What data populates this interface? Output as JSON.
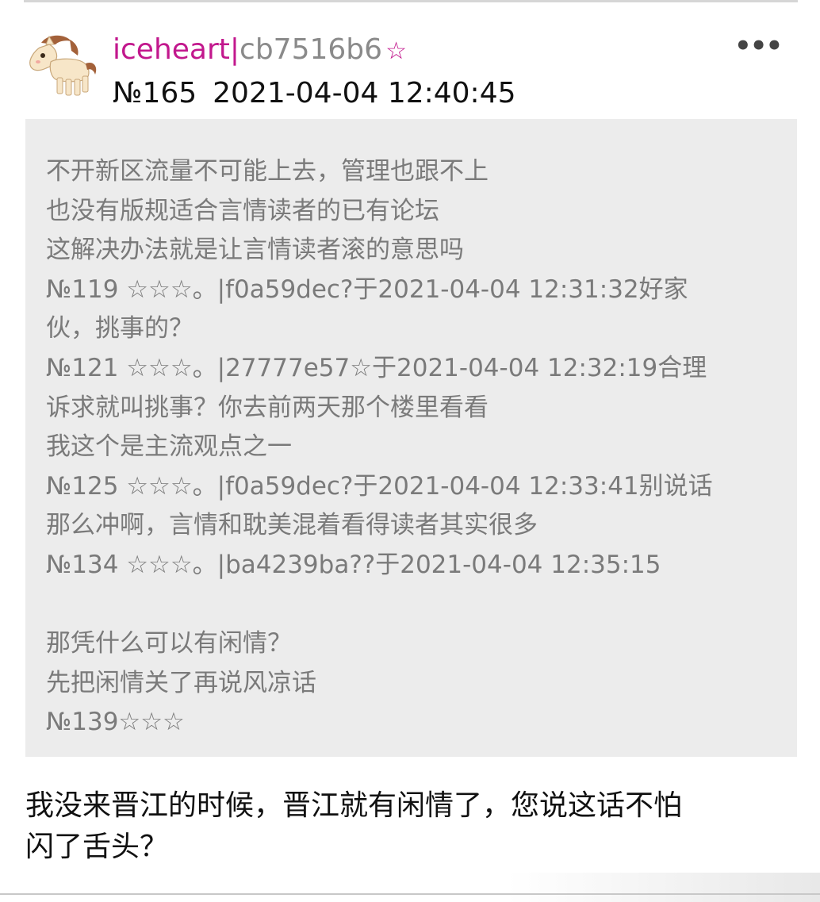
{
  "post": {
    "username": "iceheart",
    "separator": "|",
    "user_id": "cb7516b6",
    "star_mark": "☆",
    "floor": "№165",
    "timestamp": "2021-04-04 12:40:45",
    "more_icon": "more-horizontal-icon",
    "more_glyph": "•••"
  },
  "quote": {
    "lines": [
      "不开新区流量不可能上去，管理也跟不上",
      "也没有版规适合言情读者的已有论坛",
      "这解决办法就是让言情读者滚的意思吗",
      "№119 ☆☆☆。|f0a59dec?于2021-04-04 12:31:32好家",
      "伙，挑事的？",
      "№121 ☆☆☆。|27777e57☆于2021-04-04 12:32:19合理",
      "诉求就叫挑事？你去前两天那个楼里看看",
      "我这个是主流观点之一",
      "№125 ☆☆☆。|f0a59dec?于2021-04-04 12:33:41别说话",
      "那么冲啊，言情和耽美混着看得读者其实很多",
      "№134 ☆☆☆。|ba4239ba??于2021-04-04 12:35:15",
      "",
      "那凭什么可以有闲情？",
      "先把闲情关了再说风凉话",
      "№139☆☆☆"
    ]
  },
  "reply": {
    "lines": [
      "我没来晋江的时候，晋江就有闲情了，您说这话不怕",
      "闪了舌头？"
    ]
  },
  "colors": {
    "username": "#c2188d",
    "user_id": "#8a8a8a",
    "quote_bg": "#ececec",
    "quote_text": "#7a7a7a",
    "body_text": "#111111"
  },
  "icons": {
    "avatar": "pony-avatar-icon"
  }
}
